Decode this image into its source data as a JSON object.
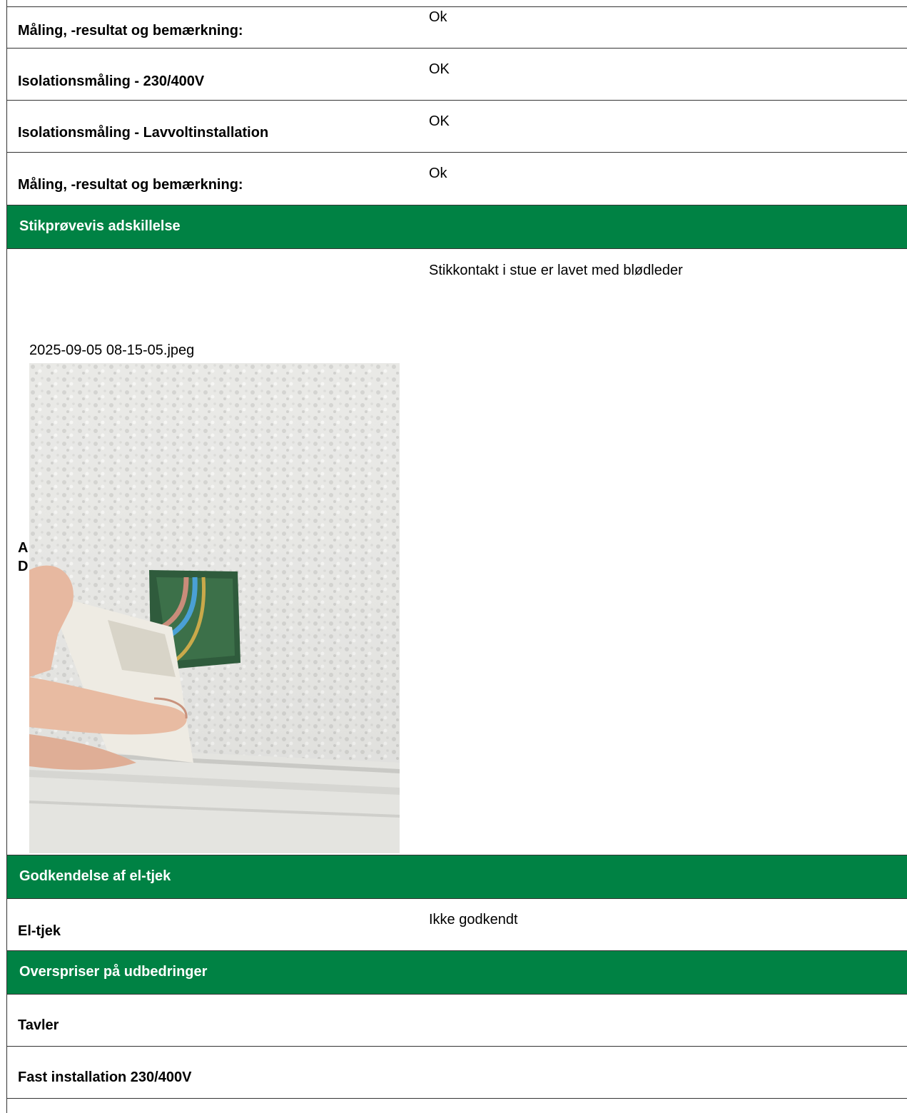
{
  "rows": [
    {
      "label": "Måling, -resultat og bemærkning:",
      "value": "Ok"
    },
    {
      "label": "Isolationsmåling  - 230/400V",
      "value": "OK"
    },
    {
      "label": "Isolationsmåling - Lavvoltinstallation",
      "value": "OK"
    },
    {
      "label": "Måling, -resultat og bemærkning:",
      "value": "Ok"
    }
  ],
  "sections": {
    "sample": {
      "title": "Stikprøvevis adskillelse",
      "value": "Stikkontakt i stue er lavet med blødleder",
      "partial_label_line1": "A",
      "partial_label_line2": "D",
      "filename": "2025-09-05 08-15-05.jpeg"
    },
    "approval": {
      "title": "Godkendelse af el-tjek",
      "label": "El-tjek",
      "value": "Ikke godkendt"
    },
    "prices": {
      "title": "Overspriser på udbedringer",
      "items": [
        "Tavler",
        "Fast installation 230/400V"
      ]
    }
  },
  "colors": {
    "section_green": "#008244"
  }
}
